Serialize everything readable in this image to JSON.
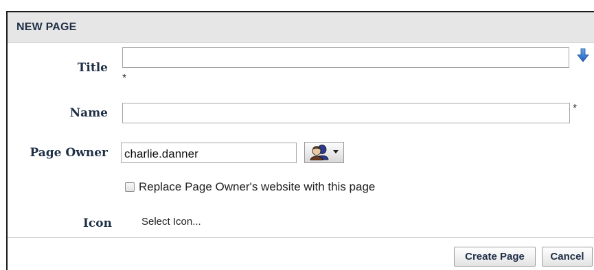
{
  "dialog": {
    "title": "NEW PAGE"
  },
  "form": {
    "title_field": {
      "label": "Title",
      "value": "",
      "required_marker": "*",
      "action_icon": "arrow-down-icon"
    },
    "name_field": {
      "label": "Name",
      "value": "",
      "required_marker": "*"
    },
    "owner_field": {
      "label": "Page Owner",
      "value": "charlie.danner",
      "picker_icon": "people-picker-icon"
    },
    "replace_website": {
      "label": "Replace Page Owner's website with this page",
      "checked": false
    },
    "icon_field": {
      "label": "Icon",
      "link_text": "Select Icon..."
    }
  },
  "buttons": {
    "create_label": "Create Page",
    "cancel_label": "Cancel"
  },
  "colors": {
    "accent_blue": "#2f78d2",
    "label_navy": "#1f2f46",
    "header_bg": "#e6e6e6"
  }
}
